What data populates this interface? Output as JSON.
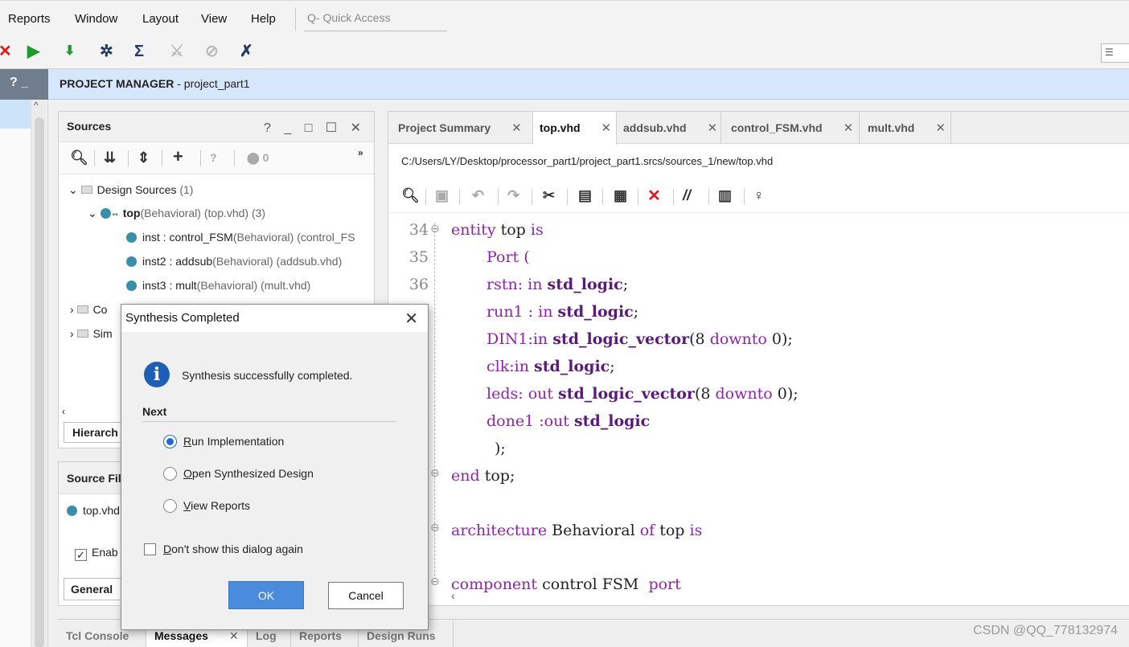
{
  "menu": {
    "items": [
      "Reports",
      "Window",
      "Layout",
      "View",
      "Help"
    ],
    "quick_access_placeholder": "Q- Quick Access"
  },
  "left_strip": {
    "header": "? _"
  },
  "project_manager": {
    "label": "PROJECT MANAGER",
    "project": "- project_part1"
  },
  "sources": {
    "title": "Sources",
    "controls": "? _ □ ☐ ✕",
    "error_count": "0",
    "tree": {
      "design_sources": "Design Sources",
      "design_sources_count": "(1)",
      "top_name": "top",
      "top_detail": "(Behavioral) (top.vhd) (3)",
      "inst1_name": "inst : control_FSM",
      "inst1_detail": "(Behavioral) (control_FS",
      "inst2_name": "inst2 : addsub",
      "inst2_detail": "(Behavioral) (addsub.vhd)",
      "inst3_name": "inst3 : mult",
      "inst3_detail": "(Behavioral) (mult.vhd)",
      "constraints_partial": "Co",
      "simulation_partial": "Sim"
    },
    "hierarchy_tab": "Hierarch"
  },
  "source_file_properties": {
    "title": "Source Fil",
    "file": "top.vhd",
    "enable": "Enab",
    "general_tab": "General"
  },
  "editor": {
    "tabs": [
      {
        "label": "Project Summary"
      },
      {
        "label": "top.vhd"
      },
      {
        "label": "addsub.vhd"
      },
      {
        "label": "control_FSM.vhd"
      },
      {
        "label": "mult.vhd"
      }
    ],
    "file_path": "C:/Users/LY/Desktop/processor_part1/project_part1.srcs/sources_1/new/top.vhd",
    "line_numbers": [
      "34",
      "35",
      "36"
    ],
    "code": {
      "l1_kw1": "entity",
      "l1_id": "top",
      "l1_kw2": "is",
      "l2_kw": "Port",
      "l2_rest": "(",
      "l3_id": "rstn:",
      "l3_kw": "in",
      "l3_ty": "std_logic",
      "l3_end": ";",
      "l4_id": "run1 :",
      "l4_kw": "in",
      "l4_ty": "std_logic",
      "l4_end": ";",
      "l5_id": "DIN1:",
      "l5_kw": "in",
      "l5_ty": "std_logic_vector",
      "l5_mid1": "(8",
      "l5_kw2": "downto",
      "l5_end": "0);",
      "l6_id": "clk:",
      "l6_kw": "in",
      "l6_ty": "std_logic",
      "l6_end": ";",
      "l7_id": "leds:",
      "l7_kw": "out",
      "l7_ty": "std_logic_vector",
      "l7_mid1": "(8",
      "l7_kw2": "downto",
      "l7_end": "0);",
      "l8_id": "done1 :",
      "l8_kw": "out",
      "l8_ty": "std_logic",
      "l9": ");",
      "l10_kw": "end",
      "l10_rest": "top;",
      "l11_kw1": "architecture",
      "l11_id": "Behavioral",
      "l11_kw2": "of",
      "l11_id2": "top",
      "l11_kw3": "is",
      "l12_kw1": "component",
      "l12_id": "control FSM",
      "l12_kw2": "port"
    }
  },
  "bottom_tabs": [
    "Tcl Console",
    "Messages",
    "Log",
    "Reports",
    "Design Runs"
  ],
  "watermark": "CSDN @QQ_778132974",
  "dialog": {
    "title": "Synthesis Completed",
    "message": "Synthesis successfully completed.",
    "next_label": "Next",
    "options": [
      {
        "mnemonic": "R",
        "rest": "un Implementation",
        "selected": true
      },
      {
        "mnemonic": "O",
        "rest": "pen Synthesized Design",
        "selected": false
      },
      {
        "mnemonic": "V",
        "rest": "iew Reports",
        "selected": false
      }
    ],
    "dont_show_mnemonic": "D",
    "dont_show_rest": "on't show this dialog again",
    "ok": "OK",
    "cancel": "Cancel"
  },
  "colors": {
    "header_blue": "#d6e6fb",
    "ok_button": "#4a8bde",
    "keyword": "#8e24aa",
    "type": "#5a1a7a",
    "dot": "#3a8fa8"
  }
}
